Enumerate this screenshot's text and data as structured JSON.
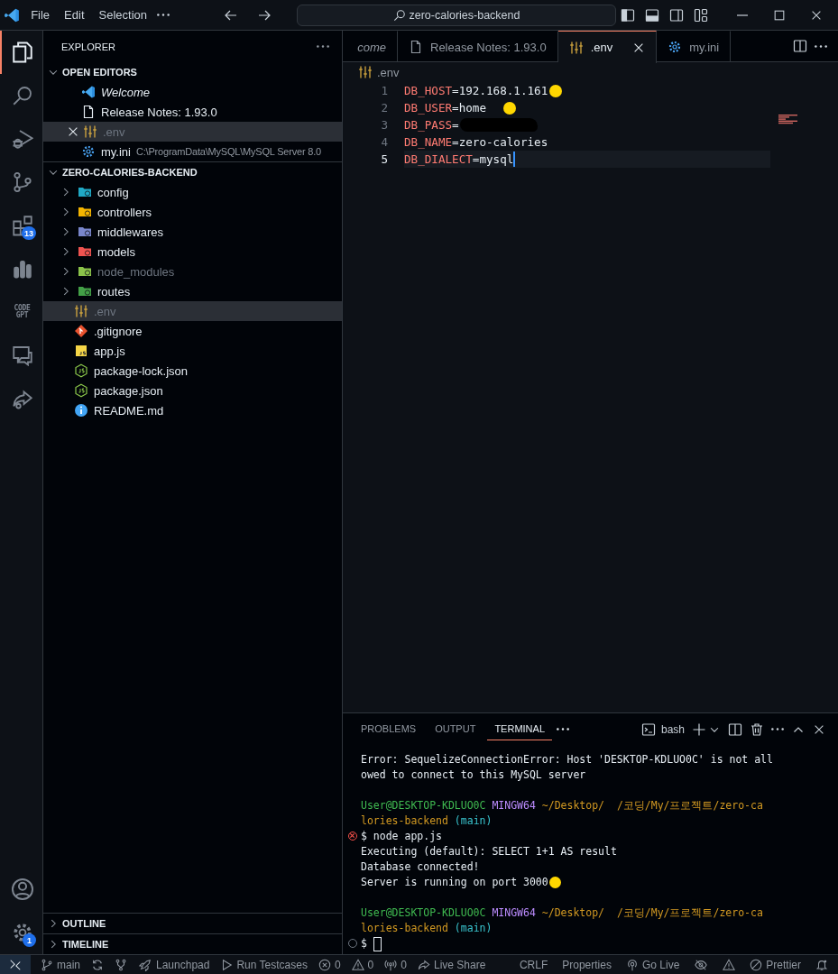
{
  "title_bar": {
    "menus": [
      "File",
      "Edit",
      "Selection"
    ],
    "search": "zero-calories-backend"
  },
  "activity_bar": {
    "items": [
      {
        "kind": "files",
        "selected": true
      },
      {
        "kind": "search",
        "selected": false
      },
      {
        "kind": "debug",
        "selected": false
      },
      {
        "kind": "git",
        "selected": false
      },
      {
        "kind": "extensions",
        "selected": false,
        "badge": "13"
      },
      {
        "kind": "chart",
        "selected": false
      },
      {
        "kind": "wordmark",
        "selected": false,
        "label": "CODE GPT"
      },
      {
        "kind": "chat",
        "selected": false
      },
      {
        "kind": "share",
        "selected": false
      }
    ],
    "bottom": [
      {
        "kind": "account",
        "selected": false
      },
      {
        "kind": "settings",
        "selected": false,
        "badge": "1"
      }
    ]
  },
  "sidebar": {
    "title": "EXPLORER",
    "open_editors": {
      "title": "OPEN EDITORS",
      "expanded": true,
      "items": [
        {
          "label": "Welcome",
          "kind": "welcome",
          "preview": true,
          "selected": false,
          "ignored": false
        },
        {
          "label": "Release Notes: 1.93.0",
          "kind": "doc",
          "preview": false,
          "selected": false,
          "ignored": false
        },
        {
          "label": ".env",
          "kind": "env",
          "preview": false,
          "selected": true,
          "ignored": true
        },
        {
          "label": "my.ini",
          "kind": "ini",
          "preview": false,
          "selected": false,
          "ignored": false,
          "description": "C:\\ProgramData\\MySQL\\MySQL Server 8.0"
        }
      ]
    },
    "project": {
      "title": "ZERO-CALORIES-BACKEND",
      "expanded": true,
      "items": [
        {
          "label": "config",
          "kind": "folder",
          "color": "#20a9c6",
          "expanded": false,
          "selected": false,
          "ignored": false
        },
        {
          "label": "controllers",
          "kind": "folder",
          "color": "#f4b400",
          "expanded": false,
          "selected": false,
          "ignored": false
        },
        {
          "label": "middlewares",
          "kind": "folder",
          "color": "#7986cb",
          "expanded": false,
          "selected": false,
          "ignored": false
        },
        {
          "label": "models",
          "kind": "folder",
          "color": "#ef5350",
          "expanded": false,
          "selected": false,
          "ignored": false
        },
        {
          "label": "node_modules",
          "kind": "folder",
          "color": "#8bc34a",
          "expanded": false,
          "selected": false,
          "ignored": true
        },
        {
          "label": "routes",
          "kind": "folder",
          "color": "#43a047",
          "expanded": false,
          "selected": false,
          "ignored": false
        },
        {
          "label": ".env",
          "kind": "env",
          "selected": true,
          "ignored": true
        },
        {
          "label": ".gitignore",
          "kind": "git",
          "selected": false,
          "ignored": false
        },
        {
          "label": "app.js",
          "kind": "js",
          "selected": false,
          "ignored": false
        },
        {
          "label": "package-lock.json",
          "kind": "node",
          "selected": false,
          "ignored": false
        },
        {
          "label": "package.json",
          "kind": "node",
          "selected": false,
          "ignored": false
        },
        {
          "label": "README.md",
          "kind": "info",
          "selected": false,
          "ignored": false
        }
      ]
    },
    "outline": {
      "title": "OUTLINE",
      "expanded": false
    },
    "timeline": {
      "title": "TIMELINE",
      "expanded": false
    }
  },
  "editor": {
    "tabs": [
      {
        "label": "come",
        "preview": true,
        "selected": false
      },
      {
        "label": "Release Notes: 1.93.0",
        "kind": "doc",
        "preview": false,
        "selected": false
      },
      {
        "label": ".env",
        "kind": "env",
        "preview": false,
        "selected": true
      },
      {
        "label": "my.ini",
        "kind": "ini",
        "preview": false,
        "selected": false
      }
    ],
    "breadcrumb": ".env",
    "lines": [
      {
        "number": "1",
        "text": "DB_HOST=192.168.1.161",
        "marker": true,
        "redacted": false,
        "selected": false
      },
      {
        "number": "2",
        "text": "DB_USER=home",
        "marker": true,
        "redacted": false,
        "selected": false
      },
      {
        "number": "3",
        "text": "DB_PASS=",
        "marker": false,
        "redacted": true,
        "selected": false
      },
      {
        "number": "4",
        "text": "DB_NAME=zero-calories",
        "marker": false,
        "redacted": false,
        "selected": false
      },
      {
        "number": "5",
        "text": "DB_DIALECT=mysql",
        "marker": false,
        "redacted": false,
        "selected": true
      }
    ]
  },
  "panel": {
    "tabs": [
      {
        "label": "PROBLEMS",
        "selected": false
      },
      {
        "label": "OUTPUT",
        "selected": false
      },
      {
        "label": "TERMINAL",
        "selected": true
      }
    ],
    "terminal_profile": "bash",
    "terminal_lines": [
      {
        "kind": "output",
        "segments": [
          {
            "text": "Error: SequelizeConnectionError: Host 'DESKTOP-KDLUO0C' is not all",
            "kind": "plain"
          }
        ]
      },
      {
        "kind": "output",
        "segments": [
          {
            "text": "owed to connect to this MySQL server",
            "kind": "plain"
          }
        ]
      },
      {
        "kind": "blank"
      },
      {
        "kind": "output",
        "segments": [
          {
            "text": "User@DESKTOP-KDLUO0C",
            "kind": "user"
          },
          {
            "text": " MINGW64",
            "kind": "host"
          },
          {
            "text": " ~/Desktop/  /코딩/My/프로젝트/zero-ca",
            "kind": "path"
          }
        ]
      },
      {
        "kind": "output",
        "segments": [
          {
            "text": "lories-backend",
            "kind": "path"
          },
          {
            "text": " (main)",
            "kind": "branch"
          }
        ]
      },
      {
        "kind": "failed-command",
        "segments": [
          {
            "text": "$ node app.js",
            "kind": "plain"
          }
        ]
      },
      {
        "kind": "output",
        "segments": [
          {
            "text": "Executing (default): SELECT 1+1 AS result",
            "kind": "plain"
          }
        ]
      },
      {
        "kind": "output",
        "segments": [
          {
            "text": "Database connected!",
            "kind": "plain"
          }
        ]
      },
      {
        "kind": "output",
        "marker": true,
        "segments": [
          {
            "text": "Server is running on port 3000",
            "kind": "plain"
          }
        ]
      },
      {
        "kind": "blank"
      },
      {
        "kind": "output",
        "segments": [
          {
            "text": "User@DESKTOP-KDLUO0C",
            "kind": "user"
          },
          {
            "text": " MINGW64",
            "kind": "host"
          },
          {
            "text": " ~/Desktop/  /코딩/My/프로젝트/zero-ca",
            "kind": "path"
          }
        ]
      },
      {
        "kind": "output",
        "segments": [
          {
            "text": "lories-backend",
            "kind": "path"
          },
          {
            "text": " (main)",
            "kind": "branch"
          }
        ]
      },
      {
        "kind": "input",
        "cursor": true,
        "segments": [
          {
            "text": "$",
            "kind": "plain"
          }
        ]
      }
    ]
  },
  "status_bar": {
    "left": [
      {
        "kind": "remote"
      },
      {
        "kind": "branch",
        "label": "main"
      },
      {
        "kind": "sync"
      },
      {
        "kind": "graph"
      },
      {
        "kind": "rocket",
        "label": "Launchpad"
      },
      {
        "kind": "run",
        "label": "Run Testcases"
      },
      {
        "kind": "error",
        "label": "0"
      },
      {
        "kind": "warning",
        "label": "0"
      },
      {
        "kind": "ports",
        "label": "0"
      },
      {
        "kind": "liveshare",
        "label": "Live Share"
      }
    ],
    "right": [
      {
        "kind": "text",
        "label": "CRLF"
      },
      {
        "kind": "text",
        "label": "Properties"
      },
      {
        "kind": "golive",
        "label": "Go Live"
      },
      {
        "kind": "eyeoff"
      },
      {
        "kind": "alert"
      },
      {
        "kind": "prettier",
        "label": "Prettier"
      },
      {
        "kind": "bell"
      }
    ]
  }
}
